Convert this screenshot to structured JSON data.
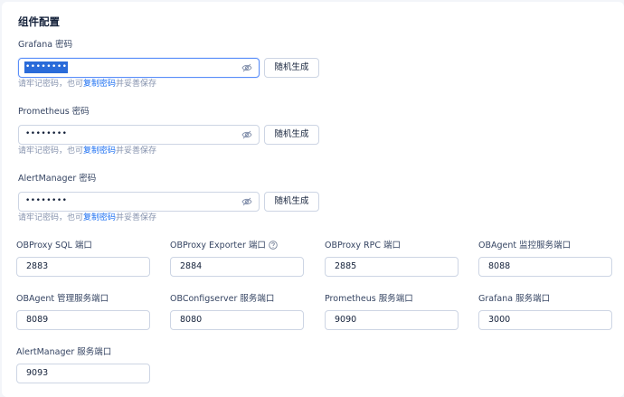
{
  "section": {
    "title": "组件配置"
  },
  "passwords": [
    {
      "label": "Grafana 密码",
      "value": "••••••••",
      "button": "随机生成",
      "hint_prefix": "请牢记密码，也可",
      "hint_link": "复制密码",
      "hint_suffix": "并妥善保存"
    },
    {
      "label": "Prometheus 密码",
      "value": "••••••••",
      "button": "随机生成",
      "hint_prefix": "请牢记密码，也可",
      "hint_link": "复制密码",
      "hint_suffix": "并妥善保存"
    },
    {
      "label": "AlertManager 密码",
      "value": "••••••••",
      "button": "随机生成",
      "hint_prefix": "请牢记密码，也可",
      "hint_link": "复制密码",
      "hint_suffix": "并妥善保存"
    }
  ],
  "ports": [
    {
      "label": "OBProxy SQL 端口",
      "value": "2883"
    },
    {
      "label": "OBProxy Exporter 端口",
      "value": "2884"
    },
    {
      "label": "OBProxy RPC 端口",
      "value": "2885"
    },
    {
      "label": "OBAgent 监控服务端口",
      "value": "8088"
    },
    {
      "label": "OBAgent 管理服务端口",
      "value": "8089"
    },
    {
      "label": "OBConfigserver 服务端口",
      "value": "8080"
    },
    {
      "label": "Prometheus 服务端口",
      "value": "9090"
    },
    {
      "label": "Grafana 服务端口",
      "value": "3000"
    },
    {
      "label": "AlertManager 服务端口",
      "value": "9093"
    }
  ],
  "colors": {
    "accent": "#1a6ef2",
    "selection": "#2a6bd9",
    "border": "#cdd5e4",
    "hint": "#8592ad"
  },
  "icons": {
    "password_toggle": "eye-invisible-icon",
    "help": "question-circle-icon"
  }
}
